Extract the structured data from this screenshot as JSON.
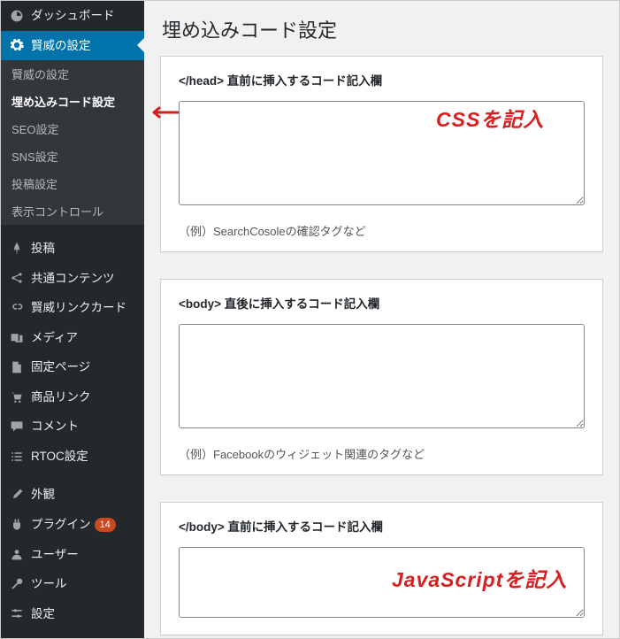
{
  "page_title": "埋め込みコード設定",
  "sidebar": {
    "dashboard": "ダッシュボード",
    "keni_settings": "賢威の設定",
    "submenu": {
      "keni": "賢威の設定",
      "embed": "埋め込みコード設定",
      "seo": "SEO設定",
      "sns": "SNS設定",
      "post": "投稿設定",
      "display": "表示コントロール"
    },
    "posts": "投稿",
    "shared": "共通コンテンツ",
    "linkcard": "賢威リンクカード",
    "media": "メディア",
    "pages": "固定ページ",
    "product_link": "商品リンク",
    "comments": "コメント",
    "rtoc": "RTOC設定",
    "appearance": "外観",
    "plugins": "プラグイン",
    "plugins_badge": "14",
    "users": "ユーザー",
    "tools": "ツール",
    "settings": "設定"
  },
  "cards": {
    "head": {
      "label": "</head> 直前に挿入するコード記入欄",
      "example": "（例）SearchCosoleの確認タグなど"
    },
    "body_after": {
      "label": "<body> 直後に挿入するコード記入欄",
      "example": "（例）Facebookのウィジェット関連のタグなど"
    },
    "body_before": {
      "label": "</body> 直前に挿入するコード記入欄"
    }
  },
  "overlays": {
    "css": "CSSを記入",
    "js": "JavaScriptを記入"
  }
}
